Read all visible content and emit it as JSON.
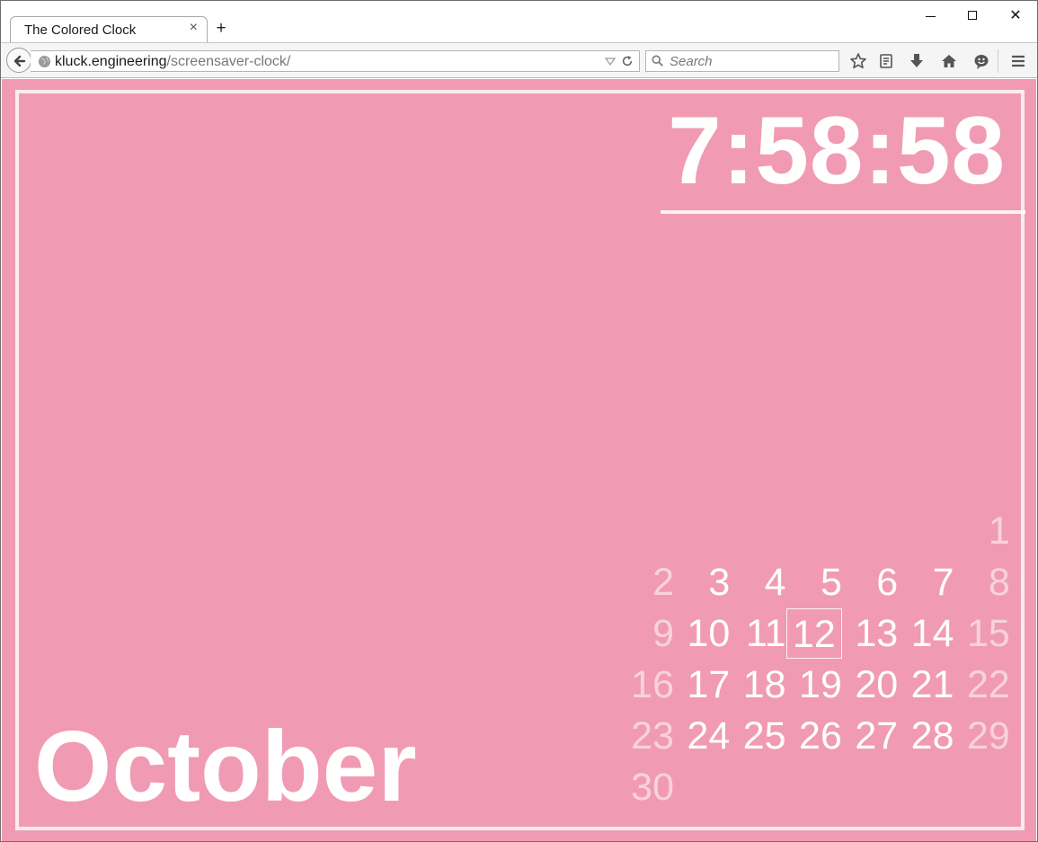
{
  "browser": {
    "tab_title": "The Colored Clock",
    "tab_close": "×",
    "new_tab": "+",
    "url_host": "kluck.engineering",
    "url_path": "/screensaver-clock/",
    "search_placeholder": "Search",
    "window_controls": {
      "close": "✕"
    },
    "toolbar_icons": [
      "back-icon",
      "globe-icon",
      "dropdown-icon",
      "reload-icon",
      "search-icon",
      "star-icon",
      "reading-list-icon",
      "download-icon",
      "home-icon",
      "smiley-icon",
      "menu-icon"
    ]
  },
  "page": {
    "background_color": "#f09bb3",
    "time": "7:58:58",
    "month": "October",
    "calendar": {
      "weeks": [
        [
          null,
          null,
          null,
          null,
          null,
          null,
          {
            "day": "1",
            "weekend": true
          }
        ],
        [
          {
            "day": "2",
            "weekend": true
          },
          {
            "day": "3"
          },
          {
            "day": "4"
          },
          {
            "day": "5"
          },
          {
            "day": "6"
          },
          {
            "day": "7"
          },
          {
            "day": "8",
            "weekend": true
          }
        ],
        [
          {
            "day": "9",
            "weekend": true
          },
          {
            "day": "10"
          },
          {
            "day": "11"
          },
          {
            "day": "12",
            "today": true
          },
          {
            "day": "13"
          },
          {
            "day": "14"
          },
          {
            "day": "15",
            "weekend": true
          }
        ],
        [
          {
            "day": "16",
            "weekend": true
          },
          {
            "day": "17"
          },
          {
            "day": "18"
          },
          {
            "day": "19"
          },
          {
            "day": "20"
          },
          {
            "day": "21"
          },
          {
            "day": "22",
            "weekend": true
          }
        ],
        [
          {
            "day": "23",
            "weekend": true
          },
          {
            "day": "24"
          },
          {
            "day": "25"
          },
          {
            "day": "26"
          },
          {
            "day": "27"
          },
          {
            "day": "28"
          },
          {
            "day": "29",
            "weekend": true
          }
        ],
        [
          {
            "day": "30",
            "weekend": true
          },
          null,
          null,
          null,
          null,
          null,
          null
        ]
      ]
    }
  }
}
